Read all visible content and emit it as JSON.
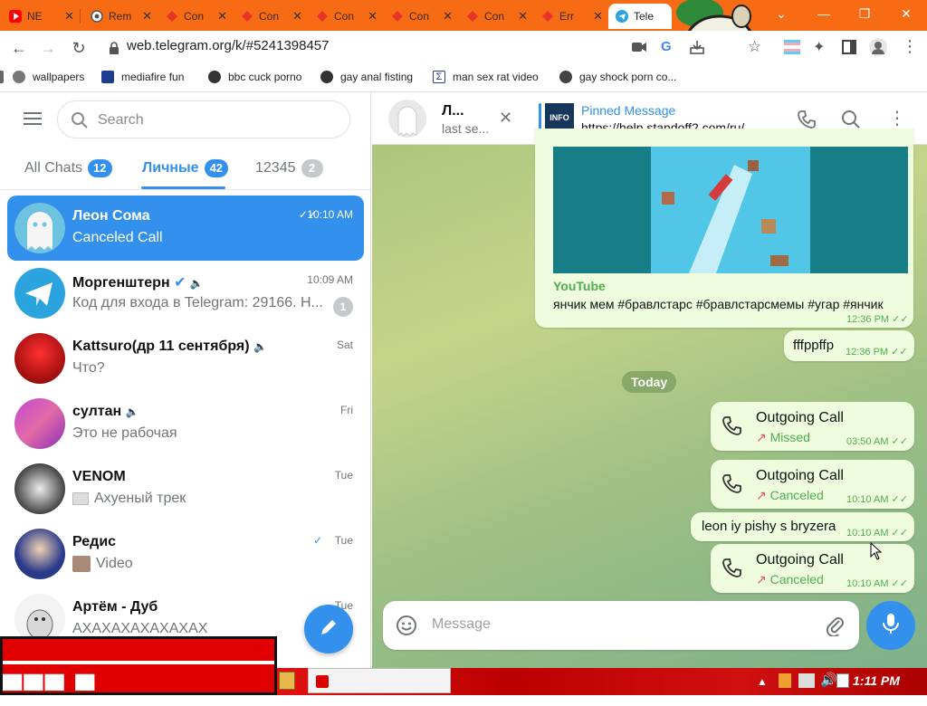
{
  "browser": {
    "tabs": [
      {
        "label": "NE",
        "icon": "youtube-icon"
      },
      {
        "label": "Rem",
        "icon": "globe-icon"
      },
      {
        "label": "Con",
        "icon": "diamond-icon"
      },
      {
        "label": "Con",
        "icon": "diamond-icon"
      },
      {
        "label": "Con",
        "icon": "diamond-icon"
      },
      {
        "label": "Con",
        "icon": "diamond-icon"
      },
      {
        "label": "Con",
        "icon": "diamond-icon"
      },
      {
        "label": "Err",
        "icon": "diamond-icon"
      },
      {
        "label": "Tele",
        "icon": "telegram-icon",
        "active": true
      }
    ],
    "url": "web.telegram.org/k/#5241398457",
    "bookmarks": [
      "wallpapers",
      "mediafire fun",
      "bbc cuck porno",
      "gay anal fisting",
      "man sex rat video",
      "gay shock porn co..."
    ]
  },
  "sidebar": {
    "search_placeholder": "Search",
    "folders": [
      {
        "label": "All Chats",
        "count": "12"
      },
      {
        "label": "Личные",
        "count": "42",
        "active": true
      },
      {
        "label": "12345",
        "count": "2"
      }
    ],
    "chats": [
      {
        "name": "Леон Сома",
        "time": "10:10 AM",
        "message": "Canceled Call",
        "selected": true
      },
      {
        "name": "Моргенштерн",
        "time": "10:09 AM",
        "message": "Код для входа в Telegram: 29166. Н...",
        "unread": "1"
      },
      {
        "name": "Kattsuro(др 11 сентября)",
        "time": "Sat",
        "message": "Что?"
      },
      {
        "name": "султан",
        "time": "Fri",
        "message": "Это не рабочая"
      },
      {
        "name": "VENOM",
        "time": "Tue",
        "message": "Ахуеный трек"
      },
      {
        "name": "Редис",
        "time": "Tue",
        "message": "Video"
      },
      {
        "name": "Артём - Дуб",
        "time": "Tue",
        "message": "АХАХАХАХАХАХАХ"
      }
    ]
  },
  "chat": {
    "title": "Л...",
    "status": "last se...",
    "pinned_label": "Pinned Message",
    "pinned_text": "https://help.standoff2.com/ru/",
    "youtube_source": "YouTube",
    "youtube_caption": "янчик мем #бравлстарс #бравлстарсмемы #угар #янчик",
    "youtube_time": "12:36 PM",
    "msg1_text": "fffppffp",
    "msg1_time": "12:36 PM",
    "date_chip": "Today",
    "call1_title": "Outgoing Call",
    "call1_status": "Missed",
    "call1_time": "03:50 AM",
    "call2_title": "Outgoing Call",
    "call2_status": "Canceled",
    "call2_time": "10:10 AM",
    "msg2_text": "leon iy pishy s bryzera",
    "msg2_time": "10:10 AM",
    "call3_title": "Outgoing Call",
    "call3_status": "Canceled",
    "call3_time": "10:10 AM",
    "composer_placeholder": "Message"
  },
  "taskbar": {
    "clock": "1:11 PM"
  },
  "colors": {
    "accent": "#3390ec",
    "tabbar": "#f66b14",
    "bubble_out": "#effdde",
    "check_green": "#4fae4e"
  }
}
